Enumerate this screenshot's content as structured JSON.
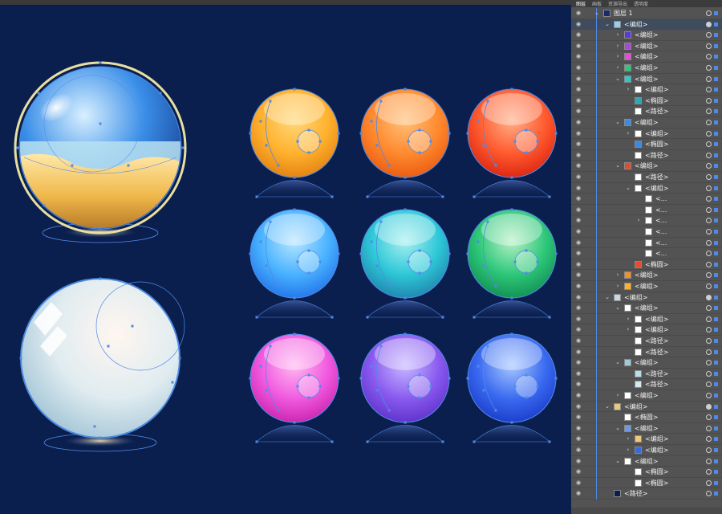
{
  "app": {
    "panel_tabs": [
      "图层",
      "画板",
      "资源导出",
      "透明度"
    ]
  },
  "colors": {
    "canvas_bg": "#0b1f4e",
    "panel_bg": "#535353",
    "selection_blue": "#4f8ae8",
    "balls": [
      {
        "name": "yellow",
        "light": "#ffd87a",
        "mid": "#ffb12e",
        "dark": "#e07d0e"
      },
      {
        "name": "orange",
        "light": "#ffc07a",
        "mid": "#ff8a2e",
        "dark": "#e8560e"
      },
      {
        "name": "red",
        "light": "#ffb08a",
        "mid": "#ff5a2e",
        "dark": "#d8200e"
      },
      {
        "name": "light-blue",
        "light": "#b8e6ff",
        "mid": "#4ab3ff",
        "dark": "#1e6ee8"
      },
      {
        "name": "cyan",
        "light": "#a8f0f0",
        "mid": "#2ec8d8",
        "dark": "#1e7ea8"
      },
      {
        "name": "green",
        "light": "#b8f0c8",
        "mid": "#2ec87a",
        "dark": "#0e8a4e"
      },
      {
        "name": "pink",
        "light": "#ffb8f0",
        "mid": "#f05ae0",
        "dark": "#c81ea8"
      },
      {
        "name": "purple",
        "light": "#c8b8ff",
        "mid": "#8a5af0",
        "dark": "#5a2ec8"
      },
      {
        "name": "blue",
        "light": "#a8c8ff",
        "mid": "#3a6af0",
        "dark": "#1838c8"
      }
    ]
  },
  "layers": [
    {
      "label": "图层 1",
      "thumb": "#1b2a6b",
      "toggle": "v",
      "indent": 0,
      "target": "ring"
    },
    {
      "label": "<编组>",
      "thumb": "#9ecbe8",
      "toggle": "v",
      "indent": 1,
      "target": "double",
      "selected": true
    },
    {
      "label": "<编组>",
      "thumb": "#5a3ad8",
      "toggle": ">",
      "indent": 2
    },
    {
      "label": "<编组>",
      "thumb": "#a84ad8",
      "toggle": ">",
      "indent": 2
    },
    {
      "label": "<编组>",
      "thumb": "#e84ad8",
      "toggle": ">",
      "indent": 2
    },
    {
      "label": "<编组>",
      "thumb": "#2ec87a",
      "toggle": ">",
      "indent": 2
    },
    {
      "label": "<编组>",
      "thumb": "#2ec8c8",
      "toggle": "v",
      "indent": 2
    },
    {
      "label": "<编组>",
      "thumb": "#ffffff",
      "toggle": ">",
      "indent": 3
    },
    {
      "label": "<椭圆>",
      "thumb": "#2ea8b8",
      "toggle": "",
      "indent": 3
    },
    {
      "label": "<路径>",
      "thumb": "#ffffff",
      "toggle": "",
      "indent": 3
    },
    {
      "label": "<编组>",
      "thumb": "#3a8ae8",
      "toggle": "v",
      "indent": 2
    },
    {
      "label": "<编组>",
      "thumb": "#ffffff",
      "toggle": ">",
      "indent": 3
    },
    {
      "label": "<椭圆>",
      "thumb": "#3a8ae8",
      "toggle": "",
      "indent": 3
    },
    {
      "label": "<路径>",
      "thumb": "#ffffff",
      "toggle": "",
      "indent": 3
    },
    {
      "label": "<编组>",
      "thumb": "#e84a2e",
      "toggle": "v",
      "indent": 2
    },
    {
      "label": "<路径>",
      "thumb": "#ffffff",
      "toggle": "",
      "indent": 3
    },
    {
      "label": "<编组>",
      "thumb": "#ffffff",
      "toggle": "v",
      "indent": 3
    },
    {
      "label": "<...",
      "thumb": "#ffffff",
      "toggle": "",
      "indent": 4
    },
    {
      "label": "<...",
      "thumb": "#ffffff",
      "toggle": "",
      "indent": 4
    },
    {
      "label": "<...",
      "thumb": "#ffffff",
      "toggle": ">",
      "indent": 4
    },
    {
      "label": "<...",
      "thumb": "#ffffff",
      "toggle": "",
      "indent": 4
    },
    {
      "label": "<...",
      "thumb": "#ffffff",
      "toggle": "",
      "indent": 4
    },
    {
      "label": "<...",
      "thumb": "#ffffff",
      "toggle": "",
      "indent": 4
    },
    {
      "label": "<椭圆>",
      "thumb": "#e84a2e",
      "toggle": "",
      "indent": 3
    },
    {
      "label": "<编组>",
      "thumb": "#f0902e",
      "toggle": ">",
      "indent": 2
    },
    {
      "label": "<编组>",
      "thumb": "#ffb12e",
      "toggle": ">",
      "indent": 2
    },
    {
      "label": "<编组>",
      "thumb": "#c8d8e8",
      "toggle": "v",
      "indent": 1,
      "target": "double"
    },
    {
      "label": "<编组>",
      "thumb": "#ffffff",
      "toggle": "v",
      "indent": 2
    },
    {
      "label": "<编组>",
      "thumb": "#ffffff",
      "toggle": ">",
      "indent": 3
    },
    {
      "label": "<编组>",
      "thumb": "#ffffff",
      "toggle": ">",
      "indent": 3
    },
    {
      "label": "<路径>",
      "thumb": "#ffffff",
      "toggle": "",
      "indent": 3
    },
    {
      "label": "<路径>",
      "thumb": "#ffffff",
      "toggle": "",
      "indent": 3
    },
    {
      "label": "<编组>",
      "thumb": "#9ecbd8",
      "toggle": "v",
      "indent": 2
    },
    {
      "label": "<路径>",
      "thumb": "#b8e0e8",
      "toggle": "",
      "indent": 3
    },
    {
      "label": "<路径>",
      "thumb": "#d8e8f0",
      "toggle": "",
      "indent": 3
    },
    {
      "label": "<编组>",
      "thumb": "#ffffff",
      "toggle": ">",
      "indent": 2
    },
    {
      "label": "<编组>",
      "thumb": "#e8c87a",
      "toggle": "v",
      "indent": 1,
      "target": "double"
    },
    {
      "label": "<椭圆>",
      "thumb": "#ffffff",
      "toggle": "",
      "indent": 2
    },
    {
      "label": "<编组>",
      "thumb": "#6a9ae8",
      "toggle": "v",
      "indent": 2
    },
    {
      "label": "<编组>",
      "thumb": "#f0c87a",
      "toggle": ">",
      "indent": 3
    },
    {
      "label": "<编组>",
      "thumb": "#3a6ad8",
      "toggle": ">",
      "indent": 3
    },
    {
      "label": "<编组>",
      "thumb": "#ffffff",
      "toggle": "v",
      "indent": 2
    },
    {
      "label": "<椭圆>",
      "thumb": "#ffffff",
      "toggle": "",
      "indent": 3
    },
    {
      "label": "<椭圆>",
      "thumb": "#ffffff",
      "toggle": "",
      "indent": 3
    },
    {
      "label": "<路径>",
      "thumb": "#0b1f4e",
      "toggle": "",
      "indent": 1
    }
  ]
}
